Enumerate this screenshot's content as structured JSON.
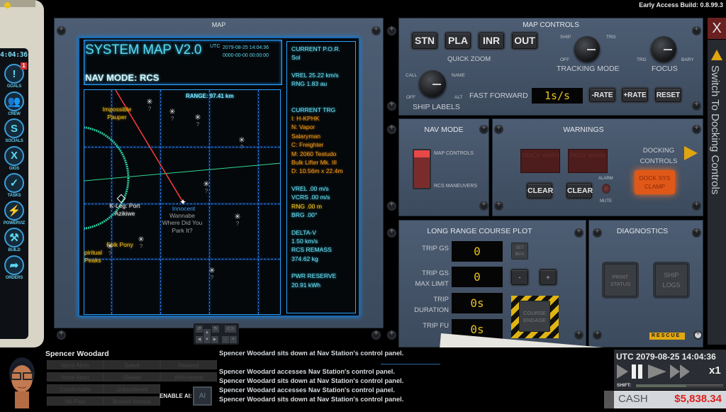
{
  "build": "Early Access Build: 0.8.99.3",
  "sidebar": {
    "time": "4:04:36",
    "items": [
      {
        "label": "GOALS",
        "icon": "!",
        "badge": "1"
      },
      {
        "label": "CREW",
        "icon": "👥"
      },
      {
        "label": "SOCIALS",
        "icon": "S"
      },
      {
        "label": "GIGS",
        "icon": "X"
      },
      {
        "label": "TASKS",
        "icon": "✓"
      },
      {
        "label": "POWERVIZ",
        "icon": "⚡"
      },
      {
        "label": "BUILD",
        "icon": "⚒"
      },
      {
        "label": "ORDERS",
        "icon": "➦"
      }
    ]
  },
  "map": {
    "panel_title": "MAP",
    "title": "SYSTEM MAP V2.0",
    "utc_label": "UTC",
    "date1": "2079-08-25 14:04:36",
    "date2": "0000-00-00 00:00:00",
    "nav_mode": "NAV MODE: RCS",
    "range": "RANGE: 97.41 km",
    "labels": {
      "impossible_pauper": "Impossible Pauper",
      "port": "K-Leg: Port Azikiwe",
      "folk_pony": "Folk Pony",
      "spiritual_peaks": "piritual Peaks",
      "innocent": "Innocent",
      "wannabe": "Wannabe",
      "where_park": "Where Did You Park It?"
    },
    "unknown_mark": "?"
  },
  "info": {
    "por_label": "CURRENT P.O.R.",
    "por_value": "Sol",
    "vrel1": "VREL 25.22 km/s",
    "rng1": "RNG 1.83 au",
    "trg_label": "CURRENT TRG",
    "trg_i": "I: H-KPHK",
    "trg_n1": "N: Vapor",
    "trg_n2": "Salaryman",
    "trg_c": "C: Freighter",
    "trg_m1": "M: 2060 Testudo",
    "trg_m2": "Bulk Lifter Mk. III",
    "trg_d": "D: 10.56m x 22.4m",
    "vrel2": "VREL .00 m/s",
    "vcrs": "VCRS .00 m/s",
    "rng2": "RNG .00 m",
    "brg": "BRG .00°",
    "dv_label": "DELTA-V",
    "dv_value": "1.50 km/s",
    "remass_label": "RCS REMASS",
    "remass_value": "374.62 kg",
    "pwr_label": "PWR RESERVE",
    "pwr_value": "20.91 kWh"
  },
  "map_controls": {
    "title": "MAP CONTROLS",
    "zoom_buttons": [
      "STN",
      "PLA",
      "INR",
      "OUT"
    ],
    "quick_zoom": "QUICK ZOOM",
    "tracking_mode": "TRACKING MODE",
    "tracking_opts": {
      "ship": "SHIP",
      "trg": "TRG",
      "off": "OFF"
    },
    "focus": "FOCUS",
    "focus_opts": {
      "trg": "TRG",
      "bary": "BARY"
    },
    "ship_labels": "SHIP LABELS",
    "label_opts": {
      "call": "CALL",
      "name": "NAME",
      "off": "OFF",
      "alt": "ALT"
    },
    "fast_forward": "FAST FORWARD",
    "ff_value": "1s/s",
    "minus_rate": "-RATE",
    "plus_rate": "+RATE",
    "reset": "RESET"
  },
  "nav_mode": {
    "title": "NAV MODE",
    "opt_map": "MAP CONTROLS",
    "opt_rcs": "RCS MANEUVERS"
  },
  "warnings": {
    "title": "WARNINGS",
    "track_warn": "TRACK WARN",
    "prox_warn": "PROX WARN",
    "clear": "CLEAR",
    "alarm": "ALARM",
    "mute": "MUTE",
    "docking_controls": "DOCKING CONTROLS",
    "dock_clamp": "DOCK SYS CLAMP"
  },
  "course": {
    "title": "LONG RANGE COURSE PLOT",
    "trip_gs_label": "TRIP GS",
    "trip_gs": "0",
    "max_label": "TRIP GS MAX LIMIT",
    "max_value": "0",
    "duration_label": "TRIP DURATION",
    "duration": "0s",
    "fuel_label": "TRIP FU",
    "fuel": "0s",
    "set_max": "SET MAX",
    "minus": "-",
    "plus": "+",
    "engage": "COURSE ENGAGE"
  },
  "diagnostics": {
    "title": "DIAGNOSTICS",
    "print_status": "PRINT STATUS",
    "ship_logs": "SHIP LOGS",
    "rescue": "RESCUE"
  },
  "side_tab": {
    "close": "X",
    "switch": "Switch To Docking Controls"
  },
  "crew": {
    "name": "Spencer Woodard",
    "statuses": [
      "Norm Atmo",
      "Sated",
      "Relaxed",
      "Norm Atmo",
      "Slaked",
      "Well-rested",
      "Comfortable",
      "Unburdened",
      "No Pain",
      "Bowels Normal"
    ],
    "enable_ai": "ENABLE AI:",
    "ai": "AI"
  },
  "log": [
    "Spencer Woodard sits down at Nav Station's control panel.",
    "Spencer Woodard accesses Nav Station's control panel.",
    "Spencer Woodard sits down at Nav Station's control panel.",
    "Spencer Woodard accesses Nav Station's control panel.",
    "Spencer Woodard sits down at Nav Station's control panel."
  ],
  "time_panel": {
    "utc": "UTC 2079-08-25 14:04:36",
    "speed": "x1",
    "shift": "SHIFT:",
    "cash_label": "CASH",
    "cash_value": "$5,838.34"
  }
}
